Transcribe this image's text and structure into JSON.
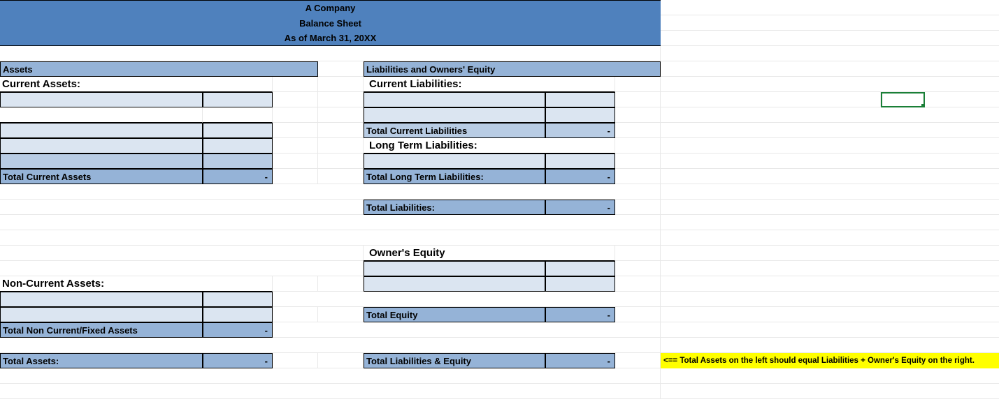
{
  "header": {
    "company": "A Company",
    "title": "Balance Sheet",
    "asof": "As of March 31, 20XX"
  },
  "left": {
    "assets": "Assets",
    "current_assets": "Current Assets:",
    "total_current_assets": "Total Current Assets",
    "total_current_assets_val": "-",
    "non_current_assets": "Non-Current Assets:",
    "total_noncurrent": "Total Non Current/Fixed Assets",
    "total_noncurrent_val": "-",
    "total_assets": "Total Assets:",
    "total_assets_val": "-"
  },
  "right": {
    "liab_eq": "Liabilities and Owners' Equity",
    "current_liab": "Current Liabilities:",
    "total_current_liab": "Total Current Liabilities",
    "total_current_liab_val": "-",
    "long_term_liab": "Long Term Liabilities:",
    "total_long_term": "Total Long Term Liabilities:",
    "total_long_term_val": "-",
    "total_liab": "Total Liabilities:",
    "total_liab_val": "-",
    "owners_equity": "Owner's Equity",
    "total_equity": "Total Equity",
    "total_equity_val": "-",
    "total_liab_eq": "Total Liabilities & Equity",
    "total_liab_eq_val": "-"
  },
  "note": "<== Total Assets on the left should equal Liabilities + Owner's Equity on the right."
}
